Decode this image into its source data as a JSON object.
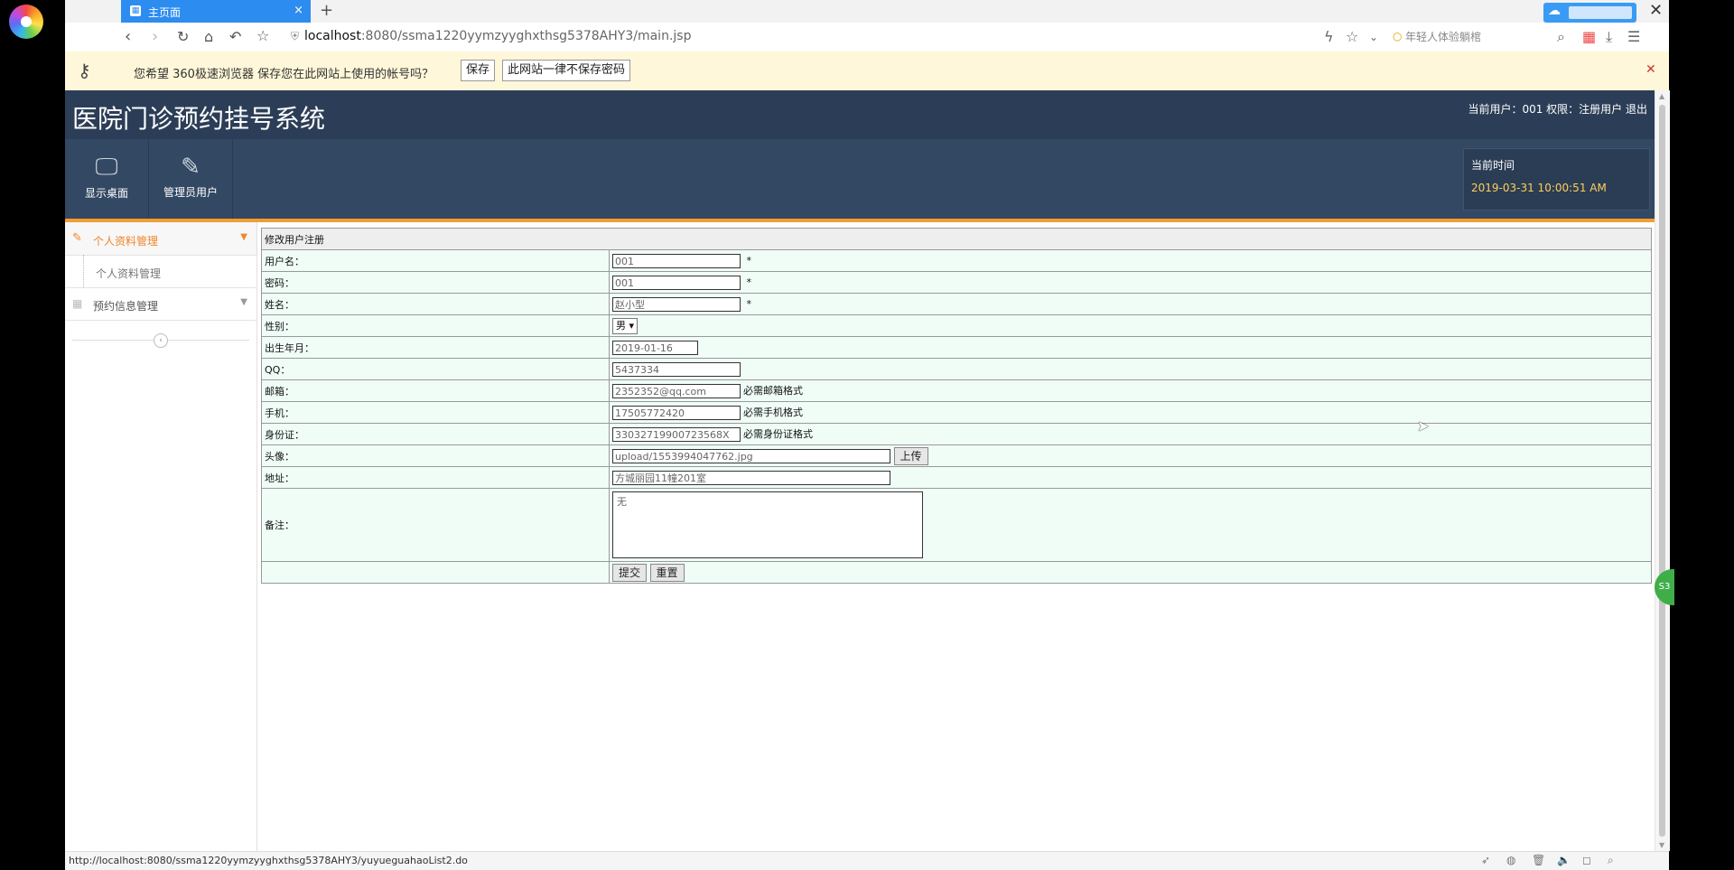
{
  "browser": {
    "tab_title": "主页面",
    "url_host": "localhost",
    "url_rest": ":8080/ssma1220yymzyyghxthsg5378AHY3/main.jsp",
    "search_placeholder": "年轻人体验躺棺",
    "status_url": "http://localhost:8080/ssma1220yymzyyghxthsg5378AHY3/yuyueguahaoList2.do",
    "badge_text": "S3"
  },
  "pwdbar": {
    "message": "您希望 360极速浏览器 保存您在此网站上使用的帐号吗？",
    "save_label": "保存",
    "never_label": "此网站一律不保存密码"
  },
  "app": {
    "title": "医院门诊预约挂号系统",
    "user_info": "当前用户：001 权限：注册用户  退出",
    "nav": [
      {
        "label": "显示桌面",
        "icon": "monitor-icon"
      },
      {
        "label": "管理员用户",
        "icon": "pencil-icon"
      }
    ],
    "time_label": "当前时间",
    "time_value": "2019-03-31 10:00:51 AM"
  },
  "sidebar": {
    "group1": "个人资料管理",
    "group1_item": "个人资料管理",
    "group2": "预约信息管理"
  },
  "form": {
    "title": "修改用户注册",
    "fields": {
      "username": {
        "label": "用户名：",
        "value": "001",
        "mark": "*"
      },
      "password": {
        "label": "密码：",
        "value": "001",
        "mark": "*"
      },
      "name": {
        "label": "姓名：",
        "value": "赵小型",
        "mark": "*"
      },
      "gender": {
        "label": "性别：",
        "value": "男"
      },
      "birth": {
        "label": "出生年月：",
        "value": "2019-01-16"
      },
      "qq": {
        "label": "QQ：",
        "value": "5437334"
      },
      "email": {
        "label": "邮箱：",
        "value": "2352352@qq.com",
        "note": "必需邮箱格式"
      },
      "phone": {
        "label": "手机：",
        "value": "17505772420",
        "note": "必需手机格式"
      },
      "idcard": {
        "label": "身份证：",
        "value": "330327199007235​68X",
        "note": "必需身份证格式"
      },
      "avatar": {
        "label": "头像：",
        "value": "upload/1553994047762.jpg",
        "button": "上传"
      },
      "address": {
        "label": "地址：",
        "value": "方城丽园11幢201室"
      },
      "remark": {
        "label": "备注：",
        "value": "无"
      }
    },
    "submit_label": "提交",
    "reset_label": "重置"
  }
}
